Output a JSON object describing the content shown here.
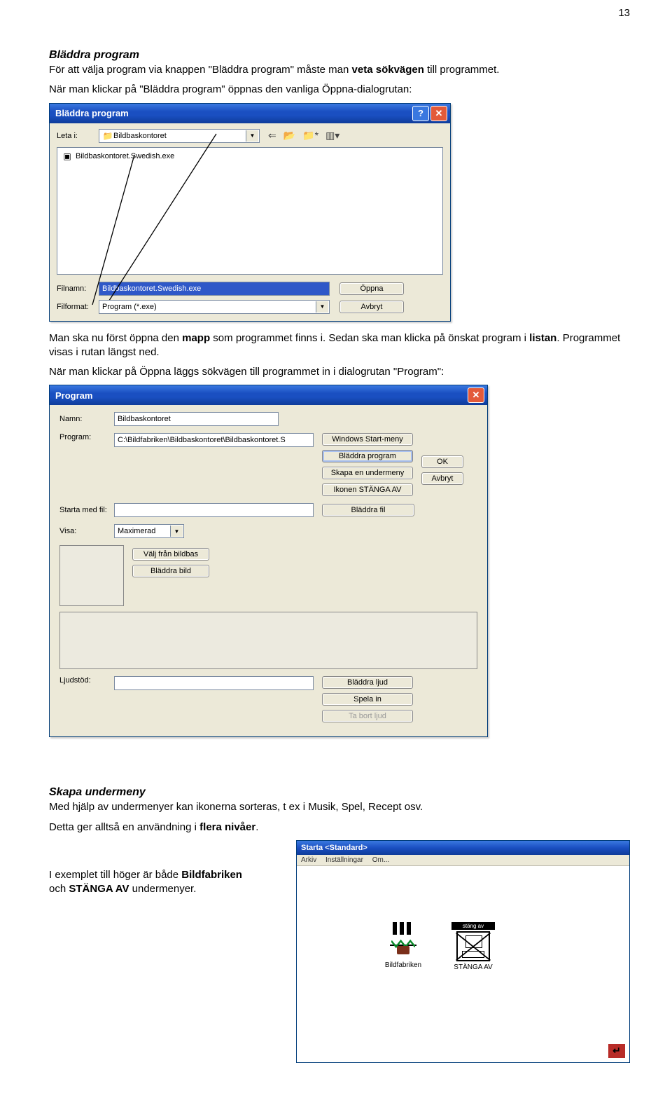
{
  "page_number": "13",
  "s1": {
    "heading": "Bläddra program",
    "p1a": "För att välja program via knappen \"Bläddra program\" måste man ",
    "p1b": "veta sökvägen",
    "p1c": " till programmet.",
    "p2": "När man klickar på \"Bläddra program\" öppnas den vanliga Öppna-dialogrutan:"
  },
  "dlg1": {
    "title": "Bläddra program",
    "leta_label": "Leta i:",
    "folder_name": "Bildbaskontoret",
    "file_item": "Bildbaskontoret.Swedish.exe",
    "filnamn_label": "Filnamn:",
    "filnamn_value": "Bildbaskontoret.Swedish.exe",
    "filformat_label": "Filformat:",
    "filformat_value": "Program (*.exe)",
    "open_btn": "Öppna",
    "cancel_btn": "Avbryt"
  },
  "s2": {
    "p1a": "Man ska nu först öppna den ",
    "p1b": "mapp",
    "p1c": " som programmet finns i. Sedan ska man klicka på önskat program i ",
    "p1d": "listan",
    "p1e": ". Programmet visas i rutan längst ned.",
    "p2": "När man klickar på Öppna läggs sökvägen till programmet in i dialogrutan \"Program\":"
  },
  "dlg2": {
    "title": "Program",
    "namn_label": "Namn:",
    "namn_value": "Bildbaskontoret",
    "program_label": "Program:",
    "program_value": "C:\\Bildfabriken\\Bildbaskontoret\\Bildbaskontoret.S",
    "win_start": "Windows Start-meny",
    "bladdra_prog": "Bläddra program",
    "skapa_under": "Skapa en undermeny",
    "ikon_stanga": "Ikonen STÄNGA AV",
    "ok": "OK",
    "avbryt": "Avbryt",
    "starta_label": "Starta med fil:",
    "bladdra_fil": "Bläddra fil",
    "visa_label": "Visa:",
    "visa_value": "Maximerad",
    "valj_bildbas": "Välj från bildbas",
    "bladdra_bild": "Bläddra bild",
    "ljud_label": "Ljudstöd:",
    "bladdra_ljud": "Bläddra ljud",
    "spela_in": "Spela in",
    "ta_bort": "Ta bort ljud"
  },
  "s3": {
    "heading": "Skapa undermeny",
    "p1": "Med hjälp av undermenyer kan ikonerna sorteras, t ex i Musik, Spel, Recept osv.",
    "p2a": "Detta ger alltså en användning i ",
    "p2b": "flera nivåer",
    "p2c": ".",
    "p3a": "I exemplet till höger är både ",
    "p3b": "Bildfabriken",
    "p3c": " och ",
    "p3d": "STÄNGA AV",
    "p3e": " undermenyer."
  },
  "standard": {
    "title": "Starta <Standard>",
    "menu1": "Arkiv",
    "menu2": "Inställningar",
    "menu3": "Om...",
    "label_stang": "stäng av",
    "icon_bild": "Bildfabriken",
    "icon_stanga": "STÄNGA AV"
  }
}
